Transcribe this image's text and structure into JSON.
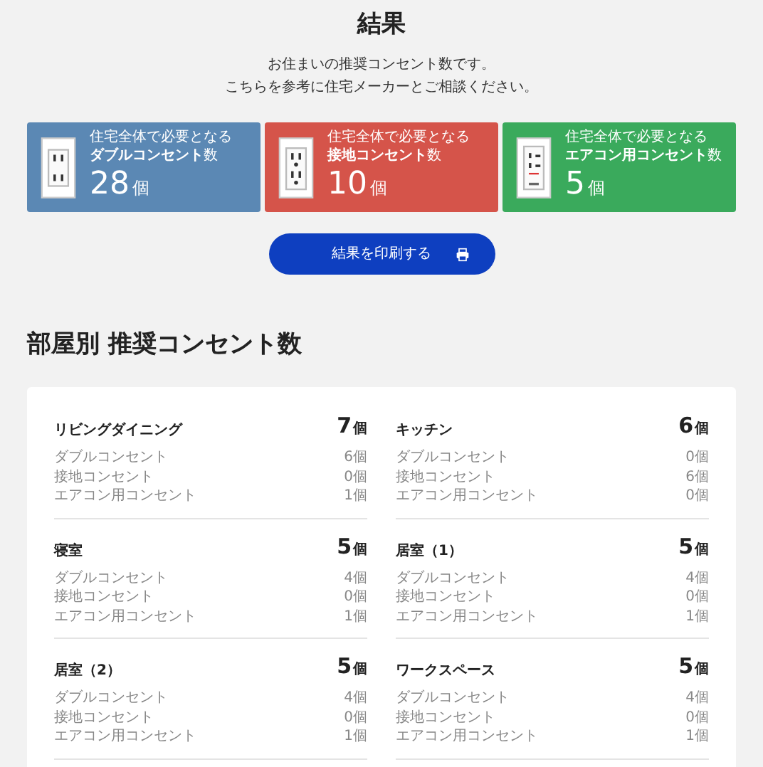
{
  "title": "結果",
  "intro": [
    "お住まいの推奨コンセント数です。",
    "こちらを参考に住宅メーカーとご相談ください。"
  ],
  "summary_cards": [
    {
      "kind": "double",
      "color": "#5b88b4",
      "caption": "住宅全体で必要となる",
      "label": "ダブルコンセント",
      "label_suffix": "数",
      "count": "28",
      "unit": "個"
    },
    {
      "kind": "ground",
      "color": "#d5544a",
      "caption": "住宅全体で必要となる",
      "label": "接地コンセント",
      "label_suffix": "数",
      "count": "10",
      "unit": "個"
    },
    {
      "kind": "aircon",
      "color": "#3aaa5c",
      "caption": "住宅全体で必要となる",
      "label": "エアコン用コンセント",
      "label_suffix": "数",
      "count": "5",
      "unit": "個"
    }
  ],
  "print_button": {
    "label": "結果を印刷する"
  },
  "section_title": "部屋別 推奨コンセント数",
  "rooms": [
    {
      "name": "リビングダイニング",
      "total": "7",
      "unit": "個",
      "items": [
        {
          "label": "ダブルコンセント",
          "value": "6個"
        },
        {
          "label": "接地コンセント",
          "value": "0個"
        },
        {
          "label": "エアコン用コンセント",
          "value": "1個"
        }
      ]
    },
    {
      "name": "キッチン",
      "total": "6",
      "unit": "個",
      "items": [
        {
          "label": "ダブルコンセント",
          "value": "0個"
        },
        {
          "label": "接地コンセント",
          "value": "6個"
        },
        {
          "label": "エアコン用コンセント",
          "value": "0個"
        }
      ]
    },
    {
      "name": "寝室",
      "total": "5",
      "unit": "個",
      "items": [
        {
          "label": "ダブルコンセント",
          "value": "4個"
        },
        {
          "label": "接地コンセント",
          "value": "0個"
        },
        {
          "label": "エアコン用コンセント",
          "value": "1個"
        }
      ]
    },
    {
      "name": "居室（1）",
      "total": "5",
      "unit": "個",
      "items": [
        {
          "label": "ダブルコンセント",
          "value": "4個"
        },
        {
          "label": "接地コンセント",
          "value": "0個"
        },
        {
          "label": "エアコン用コンセント",
          "value": "1個"
        }
      ]
    },
    {
      "name": "居室（2）",
      "total": "5",
      "unit": "個",
      "items": [
        {
          "label": "ダブルコンセント",
          "value": "4個"
        },
        {
          "label": "接地コンセント",
          "value": "0個"
        },
        {
          "label": "エアコン用コンセント",
          "value": "1個"
        }
      ]
    },
    {
      "name": "ワークスペース",
      "total": "5",
      "unit": "個",
      "items": [
        {
          "label": "ダブルコンセント",
          "value": "4個"
        },
        {
          "label": "接地コンセント",
          "value": "0個"
        },
        {
          "label": "エアコン用コンセント",
          "value": "1個"
        }
      ]
    }
  ]
}
